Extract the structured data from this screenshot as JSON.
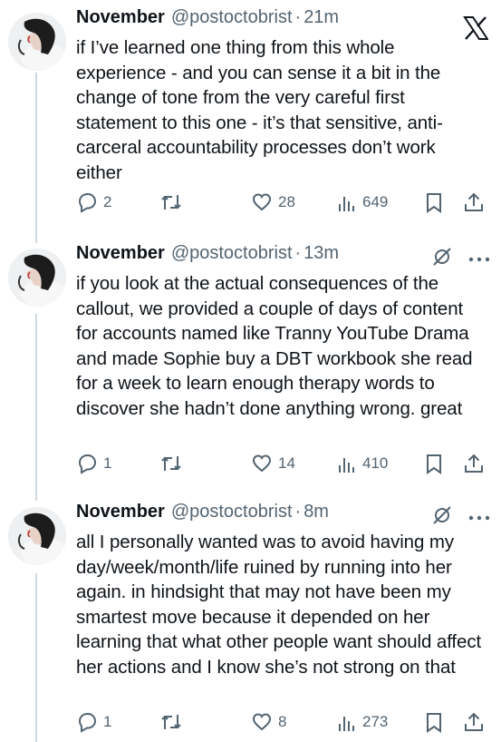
{
  "brand": {
    "logo": "x-logo"
  },
  "tweets": [
    {
      "name": "November",
      "handle": "@postoctobrist",
      "separator": "·",
      "time": "21m",
      "text": "if I’ve learned one thing from this whole experience - and you can sense it a bit in the change of tone from the very careful first statement to this one - it’s that sensitive, anti-carceral accountability processes don’t work either",
      "replies": "2",
      "likes": "28",
      "views": "649"
    },
    {
      "name": "November",
      "handle": "@postoctobrist",
      "separator": "·",
      "time": "13m",
      "text": "if you look at the actual consequences of the callout, we provided a couple of days of content for accounts named like Tranny YouTube Drama and made Sophie buy a DBT workbook she read for a week to learn enough therapy words to discover she hadn’t done anything wrong. great",
      "replies": "1",
      "likes": "14",
      "views": "410"
    },
    {
      "name": "November",
      "handle": "@postoctobrist",
      "separator": "·",
      "time": "8m",
      "text": "all I personally wanted was to avoid having my day/week/month/life ruined by running into her again. in hindsight that may not have been my smartest move because it depended on her learning that what other people want should affect her actions and I know she’s not strong on that",
      "replies": "1",
      "likes": "8",
      "views": "273"
    }
  ],
  "icons": {
    "reply": "reply-icon",
    "retweet": "retweet-icon",
    "like": "heart-icon",
    "views": "views-icon",
    "bookmark": "bookmark-icon",
    "share": "share-icon",
    "edited": "edited-icon",
    "more": "more-icon"
  },
  "colors": {
    "text": "#0f1419",
    "secondary": "#536471",
    "thread_line": "#cfd9de"
  }
}
